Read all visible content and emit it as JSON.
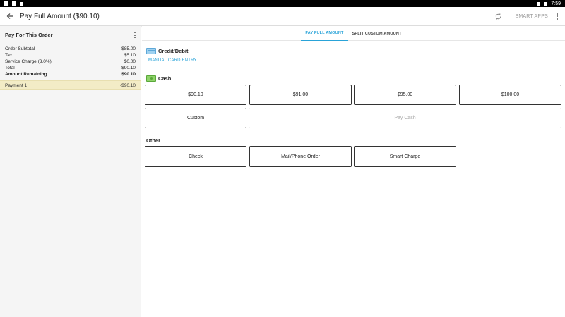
{
  "status_bar": {
    "time": "7:59"
  },
  "app_bar": {
    "title": "Pay Full Amount ($90.10)",
    "smart_apps_label": "SMART APPS"
  },
  "order_panel": {
    "title": "Pay For This Order",
    "rows": [
      {
        "label": "Order Subtotal",
        "value": "$85.00",
        "bold": false
      },
      {
        "label": "Tax",
        "value": "$5.10",
        "bold": false
      },
      {
        "label": "Service Charge (3.0%)",
        "value": "$0.00",
        "bold": false
      },
      {
        "label": "Total",
        "value": "$90.10",
        "bold": false
      },
      {
        "label": "Amount Remaining",
        "value": "$90.10",
        "bold": true
      }
    ],
    "payment": {
      "label": "Payment 1",
      "value": "-$90.10"
    }
  },
  "tabs": [
    {
      "label": "PAY FULL AMOUNT",
      "active": true
    },
    {
      "label": "SPLIT CUSTOM AMOUNT",
      "active": false
    }
  ],
  "credit": {
    "title": "Credit/Debit",
    "manual_entry_label": "MANUAL CARD ENTRY"
  },
  "cash": {
    "title": "Cash",
    "amounts": [
      "$90.10",
      "$91.00",
      "$95.00",
      "$100.00"
    ],
    "custom_label": "Custom",
    "pay_cash_label": "Pay Cash"
  },
  "other": {
    "title": "Other",
    "options": [
      "Check",
      "Mail/Phone Order",
      "Smart Charge"
    ]
  },
  "colors": {
    "accent": "#29a3d8",
    "payment_highlight": "#f3ecc6"
  }
}
